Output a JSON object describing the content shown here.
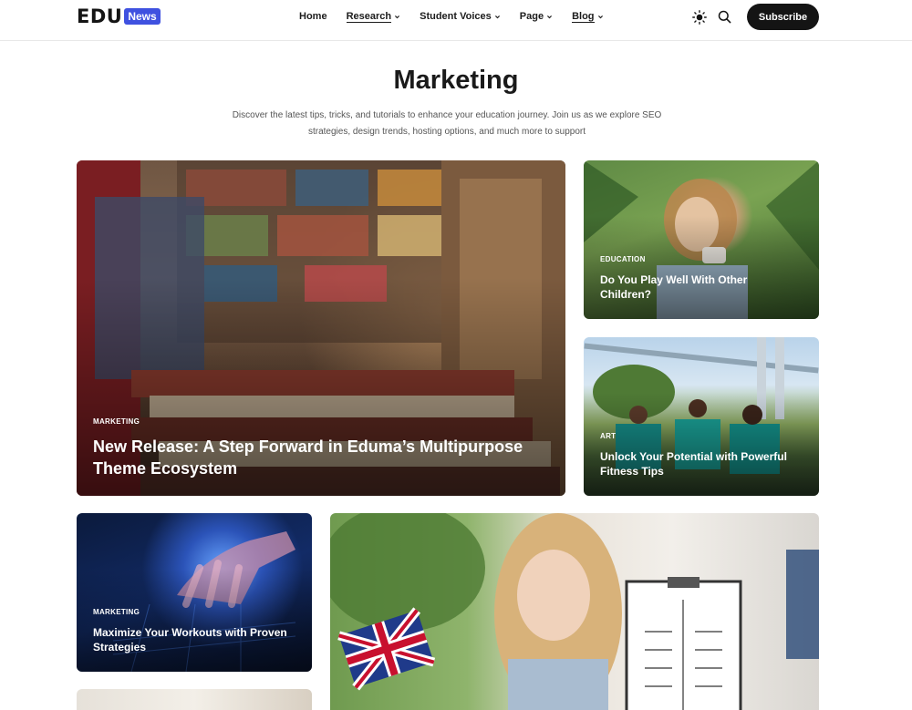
{
  "header": {
    "logo_text": "EDU",
    "logo_badge": "News",
    "nav": [
      {
        "label": "Home",
        "has_dropdown": false,
        "active": false
      },
      {
        "label": "Research",
        "has_dropdown": true,
        "active": true
      },
      {
        "label": "Student Voices",
        "has_dropdown": true,
        "active": false
      },
      {
        "label": "Page",
        "has_dropdown": true,
        "active": false
      },
      {
        "label": "Blog",
        "has_dropdown": true,
        "active": true
      }
    ],
    "theme_icon": "sun-icon",
    "search_icon": "search-icon",
    "subscribe_label": "Subscribe"
  },
  "hero": {
    "title": "Marketing",
    "description": "Discover the latest tips, tricks, and tutorials to enhance your education journey. Join us as we explore SEO strategies, design trends, hosting options, and much more to support"
  },
  "cards": [
    {
      "category": "MARKETING",
      "title": "New Release: A Step Forward in Eduma’s Multipurpose Theme Ecosystem"
    },
    {
      "category": "EDUCATION",
      "title": "Do You Play Well With Other Children?"
    },
    {
      "category": "ART",
      "title": "Unlock Your Potential with Powerful Fitness Tips"
    },
    {
      "category": "MARKETING",
      "title": "Maximize Your Workouts with Proven Strategies"
    }
  ],
  "colors": {
    "accent": "#3f51e0",
    "dark": "#141414"
  }
}
